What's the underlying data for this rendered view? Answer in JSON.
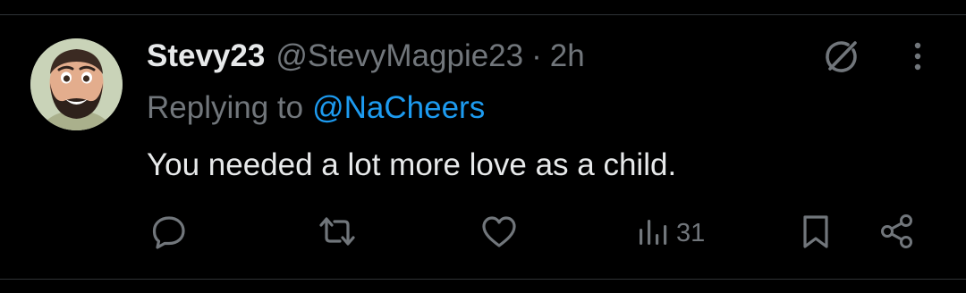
{
  "tweet": {
    "author": {
      "display_name": "Stevy23",
      "handle": "@StevyMagpie23"
    },
    "separator": "·",
    "time": "2h",
    "replying_to": {
      "prefix": "Replying to",
      "handle": "@NaCheers"
    },
    "text": "You needed a lot more love as a child.",
    "header_icons": [
      "grok-icon",
      "more-icon"
    ]
  },
  "actions": {
    "reply": {
      "icon": "reply-icon"
    },
    "retweet": {
      "icon": "retweet-icon"
    },
    "like": {
      "icon": "heart-icon"
    },
    "views": {
      "icon": "views-icon",
      "count": "31"
    },
    "bookmark": {
      "icon": "bookmark-icon"
    },
    "share": {
      "icon": "share-icon"
    }
  },
  "colors": {
    "background": "#000000",
    "text_primary": "#e7e9ea",
    "text_secondary": "#71767b",
    "accent": "#1d9bf0",
    "divider": "#2f3336"
  }
}
